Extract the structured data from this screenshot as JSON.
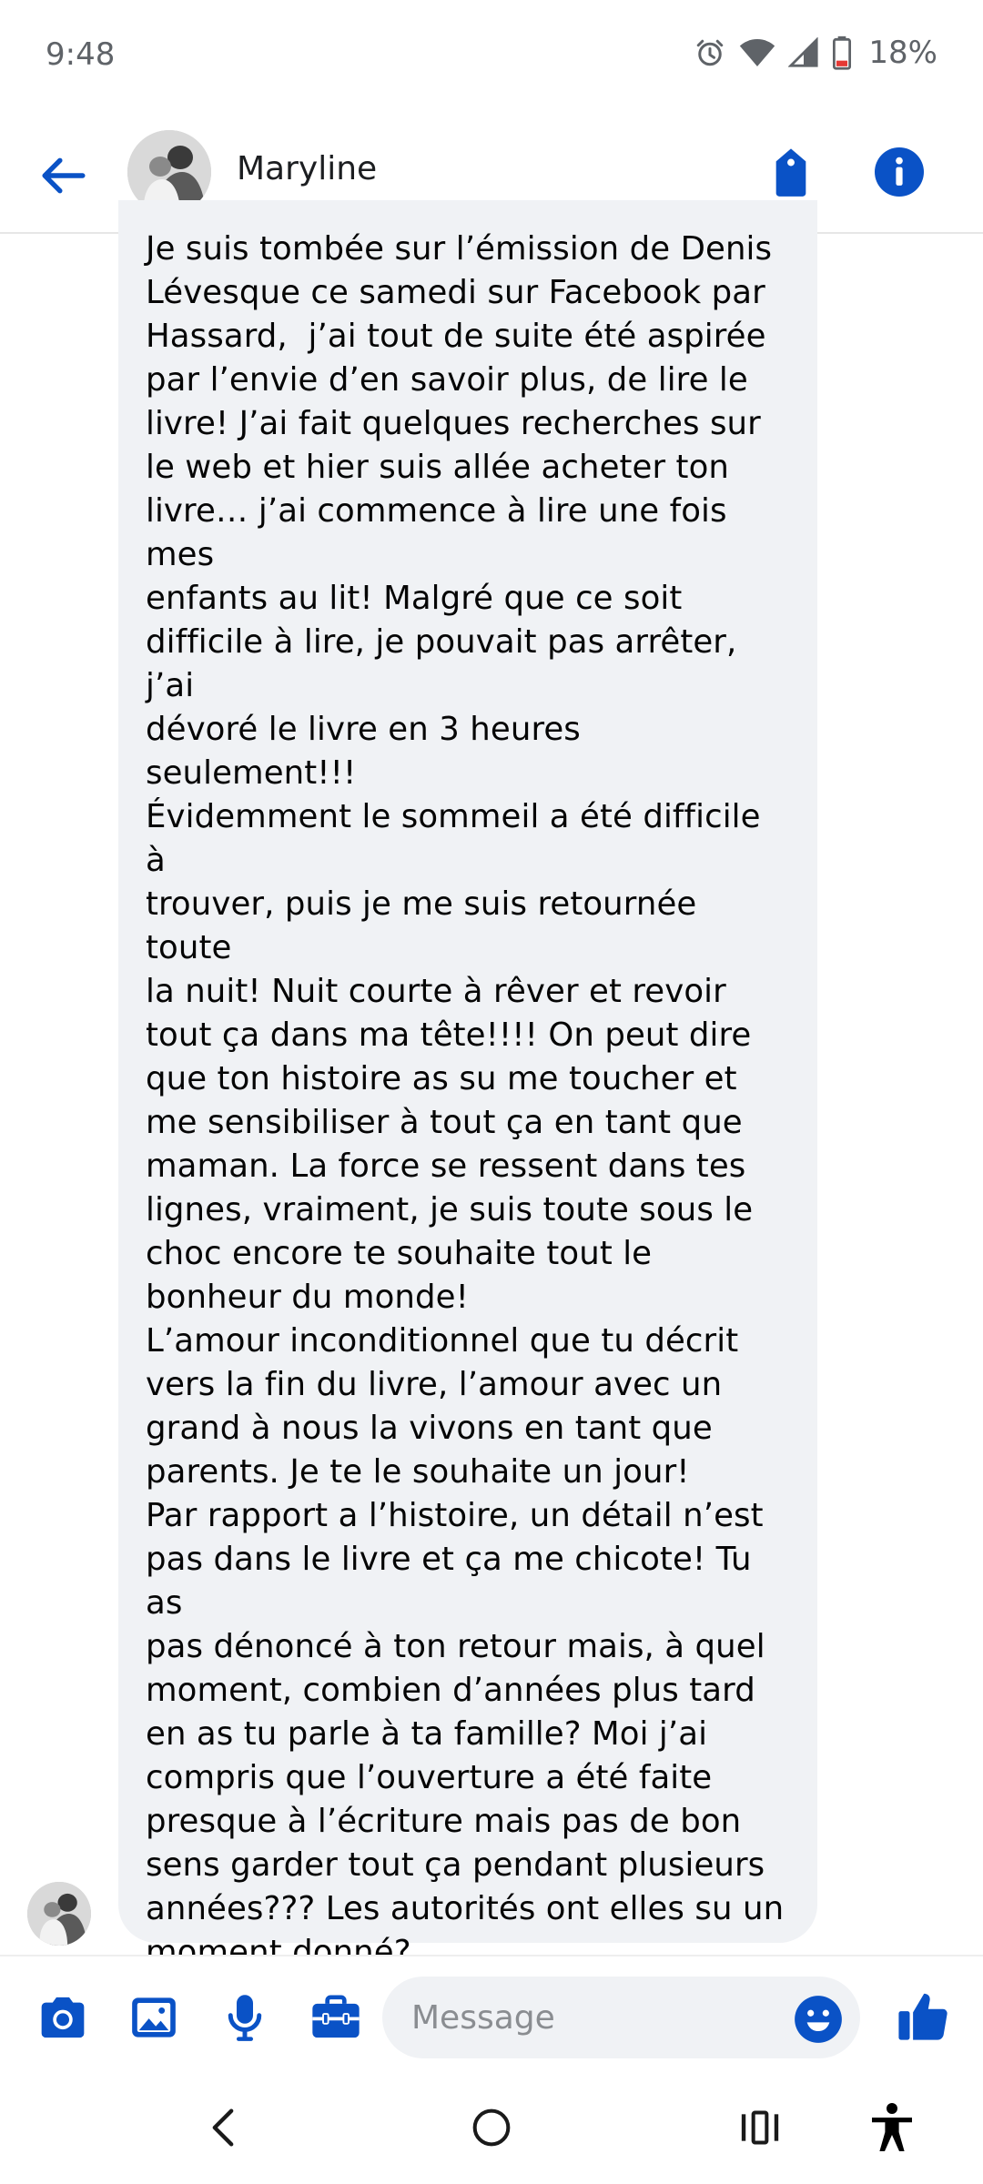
{
  "status_bar": {
    "time": "9:48",
    "battery_percent": "18%",
    "icons": [
      "alarm-icon",
      "wifi-icon",
      "signal-icon",
      "battery-icon"
    ]
  },
  "header": {
    "contact_name": "Maryline",
    "icons": [
      "back-arrow-icon",
      "tag-icon",
      "info-icon"
    ]
  },
  "message": {
    "text": "Je suis tombée sur l’émission de Denis\nLévesque ce samedi sur Facebook par\nHassard,  j’ai tout de suite été aspirée\npar l’envie d’en savoir plus, de lire le\nlivre! J’ai fait quelques recherches sur\nle web et hier suis allée acheter ton\nlivre… j’ai commence à lire une fois mes\nenfants au lit! Malgré que ce soit\ndifficile à lire, je pouvait pas arrêter, j’ai\ndévoré le livre en 3 heures seulement!!!\nÉvidemment le sommeil a été difficile à\ntrouver, puis je me suis retournée toute\nla nuit! Nuit courte à rêver et revoir\ntout ça dans ma tête!!!! On peut dire\nque ton histoire as su me toucher et\nme sensibiliser à tout ça en tant que\nmaman. La force se ressent dans tes\nlignes, vraiment, je suis toute sous le\nchoc encore te souhaite tout le\nbonheur du monde!\nL’amour inconditionnel que tu décrit\nvers la fin du livre, l’amour avec un\ngrand à nous la vivons en tant que\nparents. Je te le souhaite un jour!\nPar rapport a l’histoire, un détail n’est\npas dans le livre et ça me chicote! Tu as\npas dénoncé à ton retour mais, à quel\nmoment, combien d’années plus tard\nen as tu parle à ta famille? Moi j’ai\ncompris que l’ouverture a été faite\npresque à l’écriture mais pas de bon\nsens garder tout ça pendant plusieurs\nannées??? Les autorités ont elles su un\nmoment donné?\nEvidannevt très personnel et pas\nobligé de répondre mais on dirait que\npour moi il manque ce détail\nBonne continuité et quelle grande\nforce malgré les faiblesses,",
    "trailing_emoji": "smiling-face-icon"
  },
  "composer": {
    "placeholder": "Message",
    "icons": [
      "camera-icon",
      "image-icon",
      "microphone-icon",
      "briefcase-icon",
      "emoji-icon",
      "thumbs-up-icon"
    ]
  },
  "nav_bar": {
    "icons": [
      "back-nav-icon",
      "home-nav-icon",
      "recents-nav-icon",
      "accessibility-icon"
    ]
  },
  "colors": {
    "accent": "#0a52c6",
    "bubble": "#f0f2f5",
    "text": "#050505",
    "status_text": "#5f6368",
    "emoji_yellow": "#fdd835"
  }
}
